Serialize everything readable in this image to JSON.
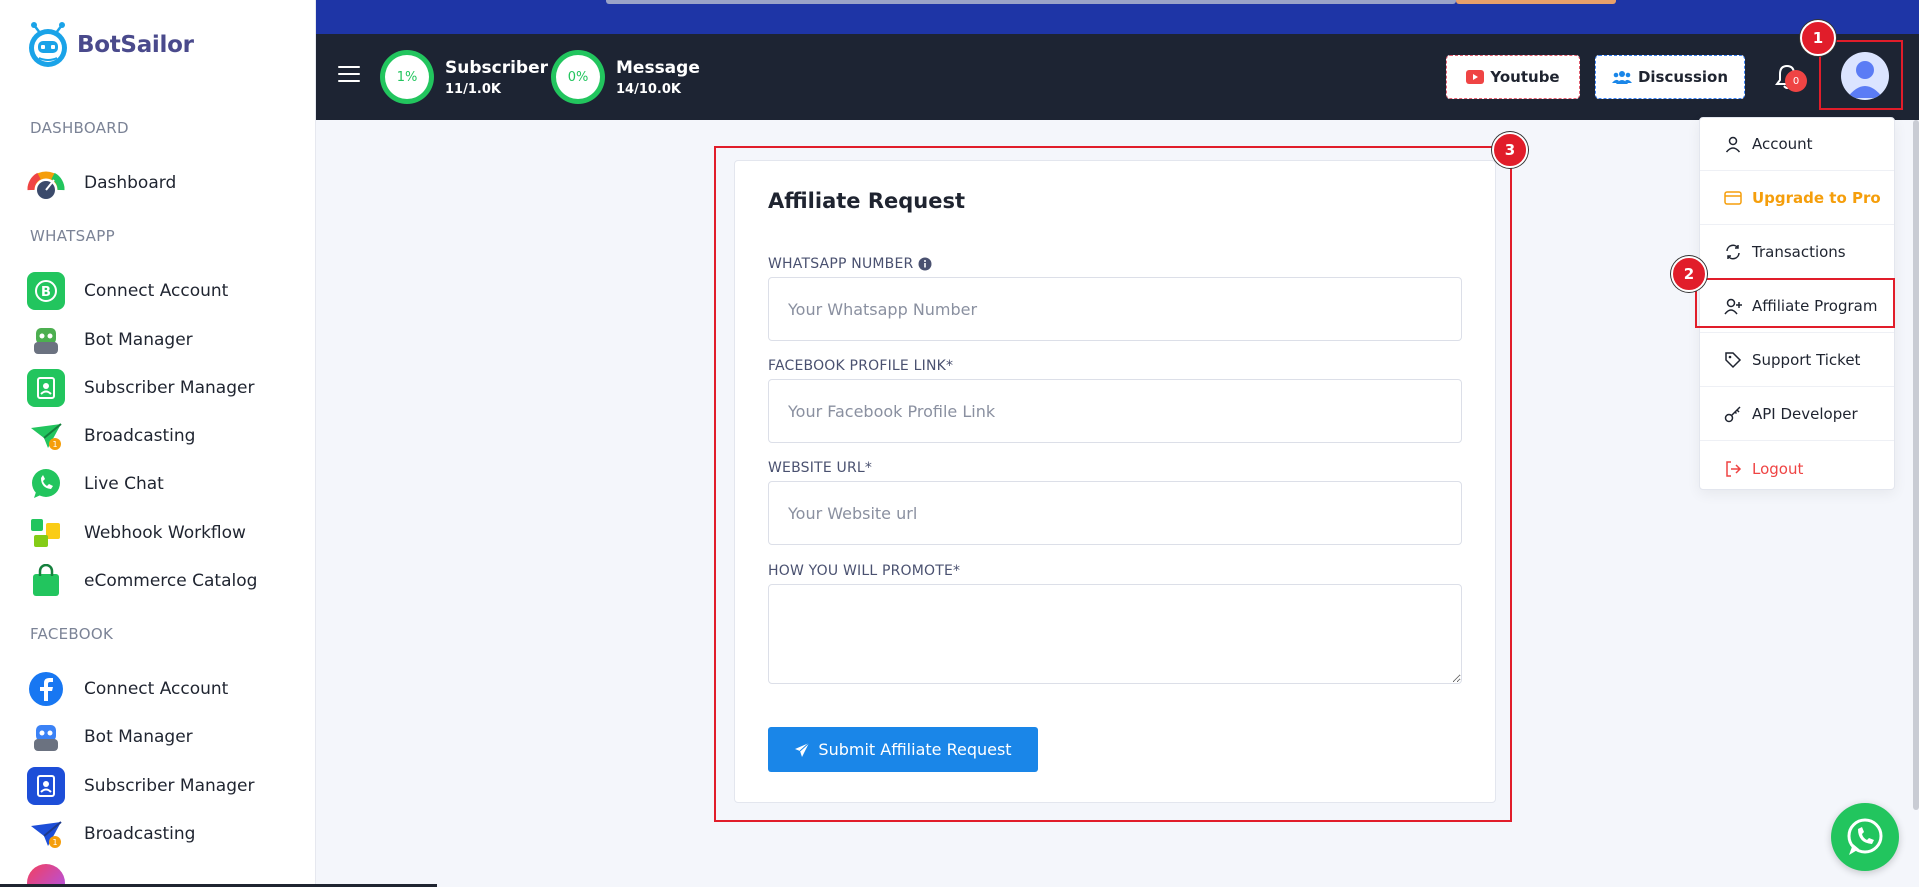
{
  "brand": {
    "name": "BotSailor"
  },
  "sidebar": {
    "sections": {
      "dashboard": "DASHBOARD",
      "whatsapp": "WHATSAPP",
      "facebook": "FACEBOOK"
    },
    "items": [
      {
        "label": "Dashboard"
      },
      {
        "label": "Connect Account"
      },
      {
        "label": "Bot Manager"
      },
      {
        "label": "Subscriber Manager"
      },
      {
        "label": "Broadcasting"
      },
      {
        "label": "Live Chat"
      },
      {
        "label": "Webhook Workflow"
      },
      {
        "label": "eCommerce Catalog"
      },
      {
        "label": "Connect Account"
      },
      {
        "label": "Bot Manager"
      },
      {
        "label": "Subscriber Manager"
      },
      {
        "label": "Broadcasting"
      }
    ]
  },
  "header": {
    "stats": [
      {
        "percent": "1%",
        "title": "Subscriber",
        "value": "11/1.0K"
      },
      {
        "percent": "0%",
        "title": "Message",
        "value": "14/10.0K"
      }
    ],
    "youtube_label": "Youtube",
    "discussion_label": "Discussion",
    "notification_count": "0"
  },
  "dropdown": {
    "items": [
      {
        "label": "Account"
      },
      {
        "label": "Upgrade to Pro"
      },
      {
        "label": "Transactions"
      },
      {
        "label": "Affiliate Program"
      },
      {
        "label": "Support Ticket"
      },
      {
        "label": "API Developer"
      },
      {
        "label": "Logout"
      }
    ]
  },
  "form": {
    "title": "Affiliate Request",
    "whatsapp_label": "WHATSAPP NUMBER",
    "whatsapp_placeholder": "Your Whatsapp Number",
    "facebook_label": "FACEBOOK PROFILE LINK*",
    "facebook_placeholder": "Your Facebook Profile Link",
    "website_label": "WEBSITE URL*",
    "website_placeholder": "Your Website url",
    "promote_label": "HOW YOU WILL PROMOTE*",
    "submit_label": "Submit Affiliate Request"
  },
  "annotations": [
    "1",
    "2",
    "3"
  ],
  "colors": {
    "primary": "#1a86e8",
    "header_bg": "#1d2433",
    "top_strip": "#1e35a6",
    "success": "#22c55e",
    "danger": "#ef4444",
    "warning": "#f59e0b",
    "annotation": "#e11d2a"
  }
}
